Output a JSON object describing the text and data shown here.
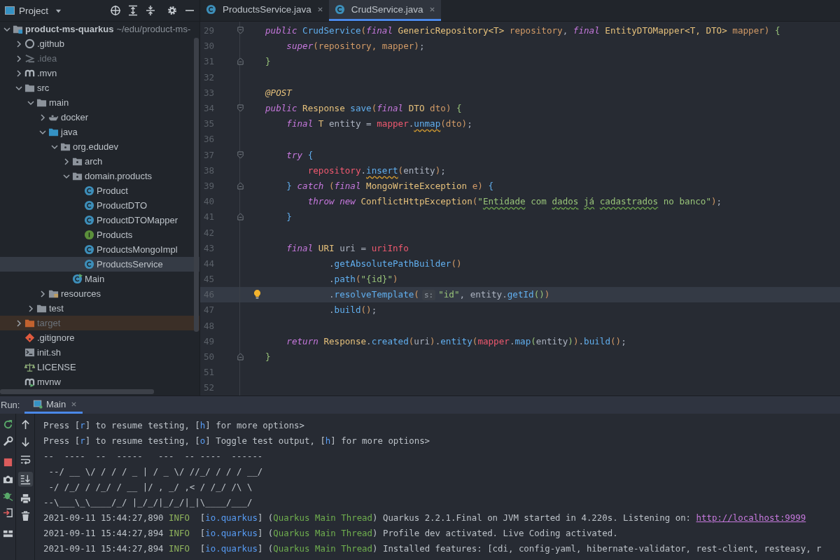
{
  "project": {
    "title": "Project",
    "tree": [
      {
        "name": "product-ms-quarkus",
        "path": "~/edu/product-ms-",
        "kind": "module",
        "selected": false,
        "dimmed": false,
        "expanded": true,
        "children": [
          {
            "name": ".github",
            "kind": "github",
            "selected": false,
            "dimmed": false,
            "expanded": false
          },
          {
            "name": ".idea",
            "kind": "idea",
            "selected": false,
            "dimmed": true,
            "expanded": false
          },
          {
            "name": ".mvn",
            "kind": "maven",
            "selected": false,
            "dimmed": false,
            "expanded": false
          },
          {
            "name": "src",
            "kind": "folder",
            "selected": false,
            "dimmed": false,
            "expanded": true,
            "children": [
              {
                "name": "main",
                "kind": "folder",
                "selected": false,
                "dimmed": false,
                "expanded": true,
                "children": [
                  {
                    "name": "docker",
                    "kind": "docker",
                    "selected": false,
                    "dimmed": false,
                    "expanded": false
                  },
                  {
                    "name": "java",
                    "kind": "source",
                    "selected": false,
                    "dimmed": false,
                    "expanded": true,
                    "children": [
                      {
                        "name": "org.edudev",
                        "kind": "package",
                        "selected": false,
                        "dimmed": false,
                        "expanded": true,
                        "children": [
                          {
                            "name": "arch",
                            "kind": "package",
                            "selected": false,
                            "dimmed": false,
                            "expanded": false
                          },
                          {
                            "name": "domain.products",
                            "kind": "package",
                            "selected": false,
                            "dimmed": false,
                            "expanded": true,
                            "children": [
                              {
                                "name": "Product",
                                "kind": "class",
                                "selected": false,
                                "dimmed": false
                              },
                              {
                                "name": "ProductDTO",
                                "kind": "class",
                                "selected": false,
                                "dimmed": false
                              },
                              {
                                "name": "ProductDTOMapper",
                                "kind": "class",
                                "selected": false,
                                "dimmed": false
                              },
                              {
                                "name": "Products",
                                "kind": "interface",
                                "selected": false,
                                "dimmed": false
                              },
                              {
                                "name": "ProductsMongoImpl",
                                "kind": "class",
                                "selected": false,
                                "dimmed": false
                              },
                              {
                                "name": "ProductsService",
                                "kind": "class",
                                "selected": true,
                                "dimmed": false
                              }
                            ]
                          },
                          {
                            "name": "Main",
                            "kind": "main",
                            "selected": false,
                            "dimmed": false
                          }
                        ]
                      }
                    ]
                  },
                  {
                    "name": "resources",
                    "kind": "resources",
                    "selected": false,
                    "dimmed": false,
                    "expanded": false
                  }
                ]
              },
              {
                "name": "test",
                "kind": "folder",
                "selected": false,
                "dimmed": false,
                "expanded": false
              }
            ]
          },
          {
            "name": "target",
            "kind": "excluded",
            "selected": false,
            "dimmed": true,
            "expanded": false
          },
          {
            "name": ".gitignore",
            "kind": "git",
            "selected": false,
            "dimmed": false
          },
          {
            "name": "init.sh",
            "kind": "shell",
            "selected": false,
            "dimmed": false
          },
          {
            "name": "LICENSE",
            "kind": "license",
            "selected": false,
            "dimmed": false
          },
          {
            "name": "mvnw",
            "kind": "mvnw",
            "selected": false,
            "dimmed": false
          }
        ]
      }
    ]
  },
  "editor_tabs": [
    {
      "label": "ProductsService.java",
      "selected": false
    },
    {
      "label": "CrudService.java",
      "selected": true
    }
  ],
  "code": {
    "lines": [
      {
        "number": "29",
        "current": false,
        "kind": "fold-start",
        "tokens": [
          {
            "kind": "kw",
            "text": "public"
          },
          {
            "kind": "decl",
            "text": " CrudService"
          },
          {
            "kind": "bracket1",
            "text": "("
          },
          {
            "kind": "kw",
            "text": "final"
          },
          {
            "kind": "type",
            "text": " GenericRepository<T>"
          },
          {
            "kind": "param",
            "text": " repository"
          },
          {
            "kind": "plain",
            "text": ", "
          },
          {
            "kind": "kw",
            "text": "final"
          },
          {
            "kind": "type",
            "text": " EntityDTOMapper<T, DTO>"
          },
          {
            "kind": "param",
            "text": " mapper"
          },
          {
            "kind": "bracket1",
            "text": ")"
          },
          {
            "kind": "bracket2",
            "text": " {"
          }
        ]
      },
      {
        "number": "30",
        "current": false,
        "tokens": [
          {
            "kind": "kw",
            "text": "    super"
          },
          {
            "kind": "bracket1",
            "text": "("
          },
          {
            "kind": "param",
            "text": "repository, mapper"
          },
          {
            "kind": "bracket1",
            "text": ")"
          },
          {
            "kind": "plain",
            "text": ";"
          }
        ]
      },
      {
        "number": "31",
        "current": false,
        "kind": "fold-end",
        "tokens": [
          {
            "kind": "bracket2",
            "text": "}"
          }
        ]
      },
      {
        "number": "32",
        "current": false
      },
      {
        "number": "33",
        "current": false,
        "tokens": [
          {
            "kind": "annotation",
            "text": "@POST"
          }
        ]
      },
      {
        "number": "34",
        "current": false,
        "kind": "fold-start",
        "tokens": [
          {
            "kind": "kw",
            "text": "public"
          },
          {
            "kind": "type",
            "text": " Response"
          },
          {
            "kind": "decl",
            "text": " save"
          },
          {
            "kind": "bracket1",
            "text": "("
          },
          {
            "kind": "kw",
            "text": "final"
          },
          {
            "kind": "type",
            "text": " DTO"
          },
          {
            "kind": "param",
            "text": " dto"
          },
          {
            "kind": "bracket1",
            "text": ")"
          },
          {
            "kind": "bracket2",
            "text": " {"
          }
        ]
      },
      {
        "number": "35",
        "current": false,
        "tokens": [
          {
            "kind": "kw",
            "text": "    final"
          },
          {
            "kind": "type",
            "text": " T"
          },
          {
            "kind": "plain",
            "text": " entity = "
          },
          {
            "kind": "field",
            "text": "mapper"
          },
          {
            "kind": "plain",
            "text": "."
          },
          {
            "kind": "callwarn",
            "text": "unmap"
          },
          {
            "kind": "bracket1",
            "text": "("
          },
          {
            "kind": "param",
            "text": "dto"
          },
          {
            "kind": "bracket1",
            "text": ")"
          },
          {
            "kind": "plain",
            "text": ";"
          }
        ]
      },
      {
        "number": "36",
        "current": false
      },
      {
        "number": "37",
        "current": false,
        "kind": "fold-start",
        "tokens": [
          {
            "kind": "kw",
            "text": "    try"
          },
          {
            "kind": "bracket3",
            "text": " {"
          }
        ]
      },
      {
        "number": "38",
        "current": false,
        "tokens": [
          {
            "kind": "field",
            "text": "        repository"
          },
          {
            "kind": "plain",
            "text": "."
          },
          {
            "kind": "callwarn",
            "text": "insert"
          },
          {
            "kind": "bracket1",
            "text": "("
          },
          {
            "kind": "plain",
            "text": "entity"
          },
          {
            "kind": "bracket1",
            "text": ")"
          },
          {
            "kind": "plain",
            "text": ";"
          }
        ]
      },
      {
        "number": "39",
        "current": false,
        "kind": "fold-end",
        "tokens": [
          {
            "kind": "bracket3",
            "text": "    }"
          },
          {
            "kind": "kw",
            "text": " catch"
          },
          {
            "kind": "bracket1",
            "text": " ("
          },
          {
            "kind": "kw",
            "text": "final"
          },
          {
            "kind": "type",
            "text": " MongoWriteException"
          },
          {
            "kind": "param",
            "text": " e"
          },
          {
            "kind": "bracket1",
            "text": ")"
          },
          {
            "kind": "bracket3",
            "text": " {"
          }
        ]
      },
      {
        "number": "40",
        "current": false,
        "tokens": [
          {
            "kind": "kw",
            "text": "        throw new"
          },
          {
            "kind": "type",
            "text": " ConflictHttpException"
          },
          {
            "kind": "bracket1",
            "text": "("
          },
          {
            "kind": "string",
            "text": "\""
          },
          {
            "kind": "typo",
            "text": "Entidade"
          },
          {
            "kind": "string",
            "text": " com "
          },
          {
            "kind": "typo",
            "text": "dados"
          },
          {
            "kind": "typo",
            "text": " já"
          },
          {
            "kind": "typo",
            "text": " cadastrados"
          },
          {
            "kind": "string",
            "text": " no banco\""
          },
          {
            "kind": "bracket1",
            "text": ")"
          },
          {
            "kind": "plain",
            "text": ";"
          }
        ]
      },
      {
        "number": "41",
        "current": false,
        "kind": "fold-end",
        "tokens": [
          {
            "kind": "bracket3",
            "text": "    }"
          }
        ]
      },
      {
        "number": "42",
        "current": false
      },
      {
        "number": "43",
        "current": false,
        "tokens": [
          {
            "kind": "kw",
            "text": "    final"
          },
          {
            "kind": "type",
            "text": " URI"
          },
          {
            "kind": "plain",
            "text": " uri = "
          },
          {
            "kind": "field",
            "text": "uriInfo"
          }
        ]
      },
      {
        "number": "44",
        "current": false,
        "tokens": [
          {
            "kind": "plain",
            "text": "            ."
          },
          {
            "kind": "call",
            "text": "getAbsolutePathBuilder"
          },
          {
            "kind": "bracket1",
            "text": "()"
          }
        ]
      },
      {
        "number": "45",
        "current": false,
        "tokens": [
          {
            "kind": "plain",
            "text": "            ."
          },
          {
            "kind": "call",
            "text": "path"
          },
          {
            "kind": "bracket1",
            "text": "("
          },
          {
            "kind": "string",
            "text": "\"{id}\""
          },
          {
            "kind": "bracket1",
            "text": ")"
          }
        ]
      },
      {
        "number": "46",
        "current": true,
        "kind": "bulb",
        "tokens": [
          {
            "kind": "plain",
            "text": "            ."
          },
          {
            "kind": "call",
            "text": "resolveTemplate"
          },
          {
            "kind": "bracket1",
            "text": "("
          },
          {
            "kind": "hint",
            "text": "s:"
          },
          {
            "kind": "string",
            "text": "\"id\""
          },
          {
            "kind": "plain",
            "text": ", entity."
          },
          {
            "kind": "call",
            "text": "getId"
          },
          {
            "kind": "bracket2",
            "text": "()"
          },
          {
            "kind": "bracket1",
            "text": ")"
          }
        ]
      },
      {
        "number": "47",
        "current": false,
        "tokens": [
          {
            "kind": "plain",
            "text": "            ."
          },
          {
            "kind": "call",
            "text": "build"
          },
          {
            "kind": "bracket1",
            "text": "()"
          },
          {
            "kind": "plain",
            "text": ";"
          }
        ]
      },
      {
        "number": "48",
        "current": false
      },
      {
        "number": "49",
        "current": false,
        "tokens": [
          {
            "kind": "kw",
            "text": "    return"
          },
          {
            "kind": "type",
            "text": " Response"
          },
          {
            "kind": "plain",
            "text": "."
          },
          {
            "kind": "call",
            "text": "created"
          },
          {
            "kind": "bracket1",
            "text": "("
          },
          {
            "kind": "plain",
            "text": "uri"
          },
          {
            "kind": "bracket1",
            "text": ")"
          },
          {
            "kind": "plain",
            "text": "."
          },
          {
            "kind": "call",
            "text": "entity"
          },
          {
            "kind": "bracket1",
            "text": "("
          },
          {
            "kind": "field",
            "text": "mapper"
          },
          {
            "kind": "plain",
            "text": "."
          },
          {
            "kind": "call",
            "text": "map"
          },
          {
            "kind": "bracket2",
            "text": "("
          },
          {
            "kind": "plain",
            "text": "entity"
          },
          {
            "kind": "bracket2",
            "text": ")"
          },
          {
            "kind": "bracket1",
            "text": ")"
          },
          {
            "kind": "plain",
            "text": "."
          },
          {
            "kind": "call",
            "text": "build"
          },
          {
            "kind": "bracket1",
            "text": "()"
          },
          {
            "kind": "plain",
            "text": ";"
          }
        ]
      },
      {
        "number": "50",
        "current": false,
        "kind": "fold-end",
        "tokens": [
          {
            "kind": "bracket2",
            "text": "}"
          }
        ]
      },
      {
        "number": "51",
        "current": false
      },
      {
        "number": "52",
        "current": false
      }
    ]
  },
  "run": {
    "label": "Run:",
    "tabs": [
      {
        "label": "Main",
        "selected": true
      }
    ],
    "autoscroll": {
      "on": true
    },
    "console": [
      {
        "tokens": [
          {
            "kind": "plain",
            "text": "Press ["
          },
          {
            "kind": "key",
            "text": "r"
          },
          {
            "kind": "plain",
            "text": "] to resume testing, ["
          },
          {
            "kind": "key",
            "text": "h"
          },
          {
            "kind": "plain",
            "text": "] for more options>"
          }
        ]
      },
      {
        "tokens": [
          {
            "kind": "plain",
            "text": "Press ["
          },
          {
            "kind": "key",
            "text": "r"
          },
          {
            "kind": "plain",
            "text": "] to resume testing, ["
          },
          {
            "kind": "key",
            "text": "o"
          },
          {
            "kind": "plain",
            "text": "] Toggle test output, ["
          },
          {
            "kind": "key",
            "text": "h"
          },
          {
            "kind": "plain",
            "text": "] for more options>"
          }
        ]
      },
      {
        "tokens": [
          {
            "kind": "plain",
            "text": "--  ----  --  -----   ---  -- ----  ------"
          }
        ]
      },
      {
        "tokens": [
          {
            "kind": "plain",
            "text": " --/ __ \\/ / / / _ | / _ \\/ //_/ / / / __/"
          }
        ]
      },
      {
        "tokens": [
          {
            "kind": "plain",
            "text": " -/ /_/ / /_/ / __ |/ , _/ ,< / /_/ /\\ \\"
          }
        ]
      },
      {
        "tokens": [
          {
            "kind": "plain",
            "text": "--\\___\\_\\____/_/ |_/_/|_/_/|_|\\____/___/"
          }
        ]
      },
      {
        "tokens": [
          {
            "kind": "plain",
            "text": "2021-09-11 15:44:27,890 "
          },
          {
            "kind": "level",
            "text": "INFO"
          },
          {
            "kind": "plain",
            "text": "  ["
          },
          {
            "kind": "key",
            "text": "io.quarkus"
          },
          {
            "kind": "plain",
            "text": "] ("
          },
          {
            "kind": "thread",
            "text": "Quarkus Main Thread"
          },
          {
            "kind": "plain",
            "text": ") Quarkus 2.2.1.Final on JVM started in 4.220s. Listening on: "
          },
          {
            "kind": "link",
            "text": "http://localhost:9999"
          }
        ]
      },
      {
        "tokens": [
          {
            "kind": "plain",
            "text": "2021-09-11 15:44:27,894 "
          },
          {
            "kind": "level",
            "text": "INFO"
          },
          {
            "kind": "plain",
            "text": "  ["
          },
          {
            "kind": "key",
            "text": "io.quarkus"
          },
          {
            "kind": "plain",
            "text": "] ("
          },
          {
            "kind": "thread",
            "text": "Quarkus Main Thread"
          },
          {
            "kind": "plain",
            "text": ") Profile dev activated. Live Coding activated."
          }
        ]
      },
      {
        "tokens": [
          {
            "kind": "plain",
            "text": "2021-09-11 15:44:27,894 "
          },
          {
            "kind": "level",
            "text": "INFO"
          },
          {
            "kind": "plain",
            "text": "  ["
          },
          {
            "kind": "key",
            "text": "io.quarkus"
          },
          {
            "kind": "plain",
            "text": "] ("
          },
          {
            "kind": "thread",
            "text": "Quarkus Main Thread"
          },
          {
            "kind": "plain",
            "text": ") Installed features: [cdi, config-yaml, hibernate-validator, rest-client, resteasy, r"
          }
        ]
      }
    ]
  }
}
